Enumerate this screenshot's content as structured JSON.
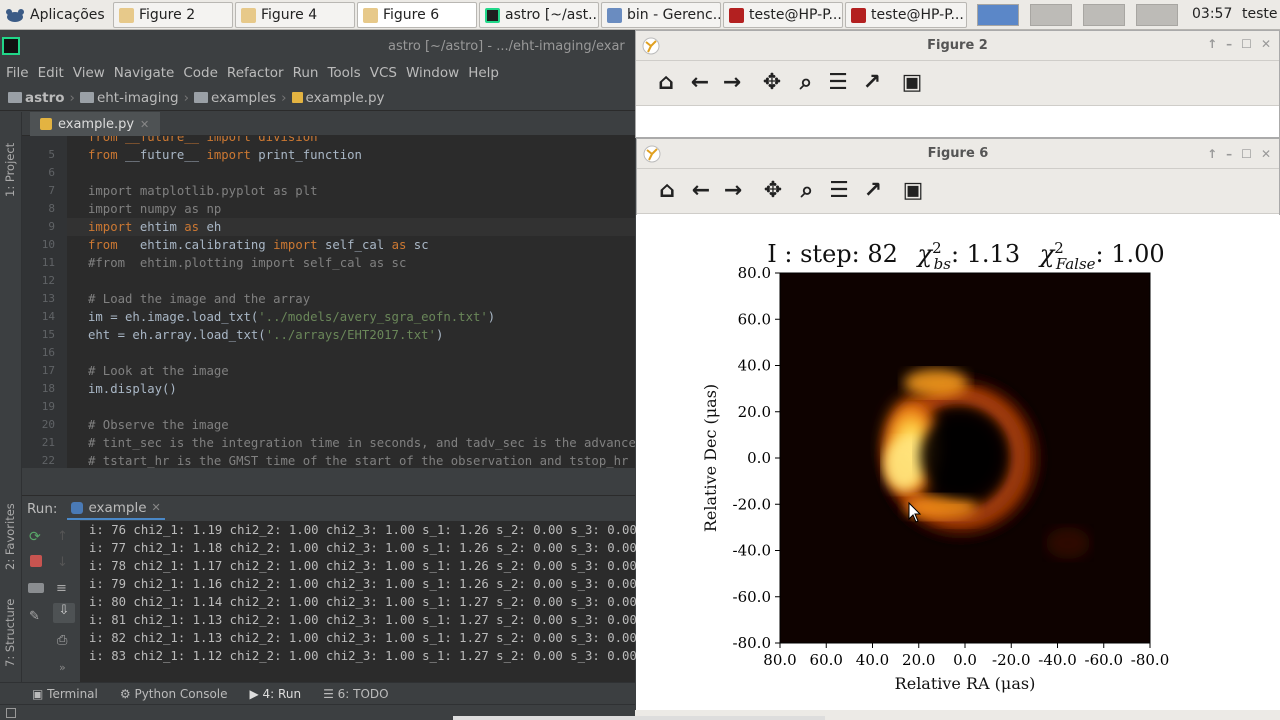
{
  "taskbar": {
    "menu_label": "Aplicações",
    "tasks": [
      "Figure 2",
      "Figure 4",
      "Figure 6",
      "astro [~/ast...",
      "bin - Gerenc...",
      "teste@HP-P...",
      "teste@HP-P..."
    ],
    "clock": "03:57",
    "trailing": "teste"
  },
  "pycharm": {
    "window_title": "astro [~/astro] - .../eht-imaging/exar",
    "menu": [
      "File",
      "Edit",
      "View",
      "Navigate",
      "Code",
      "Refactor",
      "Run",
      "Tools",
      "VCS",
      "Window",
      "Help"
    ],
    "breadcrumb": [
      "astro",
      "eht-imaging",
      "examples",
      "example.py"
    ],
    "tab": "example.py",
    "side_labels": [
      "1: Project",
      "2: Favorites",
      "7: Structure"
    ],
    "run_label": "Run:",
    "run_config": "example",
    "bottom_tabs": [
      "Terminal",
      "Python Console",
      "4: Run",
      "6: TODO"
    ],
    "code_lines": [
      {
        "n": "",
        "parts": [
          {
            "t": "from __future__ import division",
            "c": "kw"
          }
        ]
      },
      {
        "n": "5",
        "parts": [
          {
            "t": "from ",
            "c": "kw"
          },
          {
            "t": "__future__ ",
            "c": ""
          },
          {
            "t": "import ",
            "c": "kw"
          },
          {
            "t": "print_function",
            "c": ""
          }
        ]
      },
      {
        "n": "6",
        "parts": []
      },
      {
        "n": "7",
        "parts": [
          {
            "t": "import matplotlib.pyplot as plt",
            "c": "gr"
          }
        ]
      },
      {
        "n": "8",
        "parts": [
          {
            "t": "import numpy as np",
            "c": "gr"
          }
        ]
      },
      {
        "n": "9",
        "parts": [
          {
            "t": "import ",
            "c": "kw"
          },
          {
            "t": "ehtim ",
            "c": ""
          },
          {
            "t": "as ",
            "c": "kw"
          },
          {
            "t": "eh",
            "c": ""
          }
        ]
      },
      {
        "n": "10",
        "parts": [
          {
            "t": "from ",
            "c": "kw"
          },
          {
            "t": "  ehtim.calibrating ",
            "c": ""
          },
          {
            "t": "import ",
            "c": "kw"
          },
          {
            "t": "self_cal ",
            "c": ""
          },
          {
            "t": "as ",
            "c": "kw"
          },
          {
            "t": "sc",
            "c": ""
          }
        ]
      },
      {
        "n": "11",
        "parts": [
          {
            "t": "#from  ehtim.plotting import self_cal as sc",
            "c": "gr"
          }
        ]
      },
      {
        "n": "12",
        "parts": []
      },
      {
        "n": "13",
        "parts": [
          {
            "t": "# Load the image and the array",
            "c": "gr"
          }
        ]
      },
      {
        "n": "14",
        "parts": [
          {
            "t": "im = eh.image.load_txt(",
            "c": ""
          },
          {
            "t": "'../models/avery_sgra_eofn.txt'",
            "c": "st"
          },
          {
            "t": ")",
            "c": ""
          }
        ]
      },
      {
        "n": "15",
        "parts": [
          {
            "t": "eht = eh.array.load_txt(",
            "c": ""
          },
          {
            "t": "'../arrays/EHT2017.txt'",
            "c": "st"
          },
          {
            "t": ")",
            "c": ""
          }
        ]
      },
      {
        "n": "16",
        "parts": []
      },
      {
        "n": "17",
        "parts": [
          {
            "t": "# Look at the image",
            "c": "gr"
          }
        ]
      },
      {
        "n": "18",
        "parts": [
          {
            "t": "im.display()",
            "c": ""
          }
        ]
      },
      {
        "n": "19",
        "parts": []
      },
      {
        "n": "20",
        "parts": [
          {
            "t": "# Observe the image",
            "c": "gr"
          }
        ]
      },
      {
        "n": "21",
        "parts": [
          {
            "t": "# tint_sec is the integration time in seconds, and tadv_sec is the advance tim",
            "c": "gr"
          }
        ]
      },
      {
        "n": "22",
        "parts": [
          {
            "t": "# tstart_hr is the GMST time of the start of the observation and tstop_hr is t",
            "c": "gr"
          }
        ]
      }
    ],
    "console_lines": [
      "i: 76 chi2_1: 1.19 chi2_2: 1.00 chi2_3: 1.00 s_1: 1.26 s_2: 0.00 s_3: 0.00",
      "i: 77 chi2_1: 1.18 chi2_2: 1.00 chi2_3: 1.00 s_1: 1.26 s_2: 0.00 s_3: 0.00",
      "i: 78 chi2_1: 1.17 chi2_2: 1.00 chi2_3: 1.00 s_1: 1.26 s_2: 0.00 s_3: 0.00",
      "i: 79 chi2_1: 1.16 chi2_2: 1.00 chi2_3: 1.00 s_1: 1.26 s_2: 0.00 s_3: 0.00",
      "i: 80 chi2_1: 1.14 chi2_2: 1.00 chi2_3: 1.00 s_1: 1.27 s_2: 0.00 s_3: 0.00",
      "i: 81 chi2_1: 1.13 chi2_2: 1.00 chi2_3: 1.00 s_1: 1.27 s_2: 0.00 s_3: 0.00",
      "i: 82 chi2_1: 1.13 chi2_2: 1.00 chi2_3: 1.00 s_1: 1.27 s_2: 0.00 s_3: 0.00",
      "i: 83 chi2_1: 1.12 chi2_2: 1.00 chi2_3: 1.00 s_1: 1.27 s_2: 0.00 s_3: 0.00"
    ]
  },
  "figure2": {
    "title": "Figure 2"
  },
  "figure6": {
    "title": "Figure 6"
  },
  "toolbar_icons": [
    "home-icon",
    "back-arrow-icon",
    "forward-arrow-icon",
    "pan-icon",
    "zoom-icon",
    "subplots-icon",
    "edit-axes-icon",
    "save-icon"
  ],
  "chart_data": {
    "type": "heatmap",
    "title_prefix": "I : step: 82",
    "chi_bs_label": "bs",
    "chi_bs_value": ": 1.13",
    "chi_false_label": "False",
    "chi_false_value": ": 1.00",
    "xlabel": "Relative RA (μas)",
    "ylabel": "Relative Dec (μas)",
    "xlim": [
      80,
      -80
    ],
    "ylim": [
      -80,
      80
    ],
    "x_ticks": [
      "80.0",
      "60.0",
      "40.0",
      "20.0",
      "0.0",
      "-20.0",
      "-40.0",
      "-60.0",
      "-80.0"
    ],
    "y_ticks": [
      "80.0",
      "60.0",
      "40.0",
      "20.0",
      "0.0",
      "-20.0",
      "-40.0",
      "-60.0",
      "-80.0"
    ],
    "colormap": "afmhot",
    "feature": "crescent ring, bright on left (east) side",
    "colors": {
      "ring_bright": "#ffe27a",
      "ring_mid": "#f08a14",
      "ring_dim": "#7a2a00",
      "background": "#000000"
    }
  }
}
